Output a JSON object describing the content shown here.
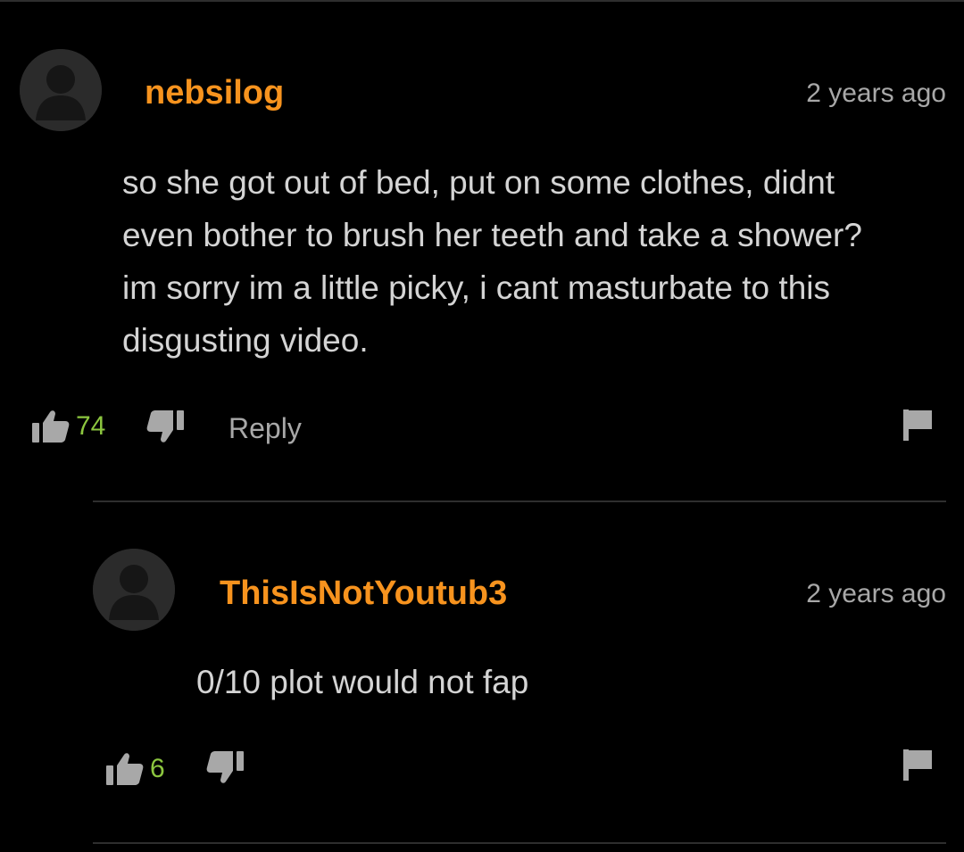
{
  "comments": [
    {
      "username": "nebsilog",
      "timestamp": "2 years ago",
      "lines": [
        "so she got out of bed, put on some clothes, didnt",
        "even bother to brush her teeth and take a shower?",
        "im sorry im a little picky, i cant masturbate to this",
        "disgusting video."
      ],
      "likes": "74",
      "reply_label": "Reply"
    },
    {
      "username": "ThisIsNotYoutub3",
      "timestamp": "2 years ago",
      "lines": [
        "0/10 plot would not fap"
      ],
      "likes": "6"
    }
  ],
  "icons": {
    "like": "thumbs-up-icon",
    "dislike": "thumbs-down-icon",
    "flag": "flag-icon",
    "avatar": "default-user-avatar"
  },
  "colors": {
    "background": "#000000",
    "username": "#f7931e",
    "like_count": "#8cc63f",
    "muted_text": "#a8a8a8",
    "body_text": "#d4d4d4"
  }
}
